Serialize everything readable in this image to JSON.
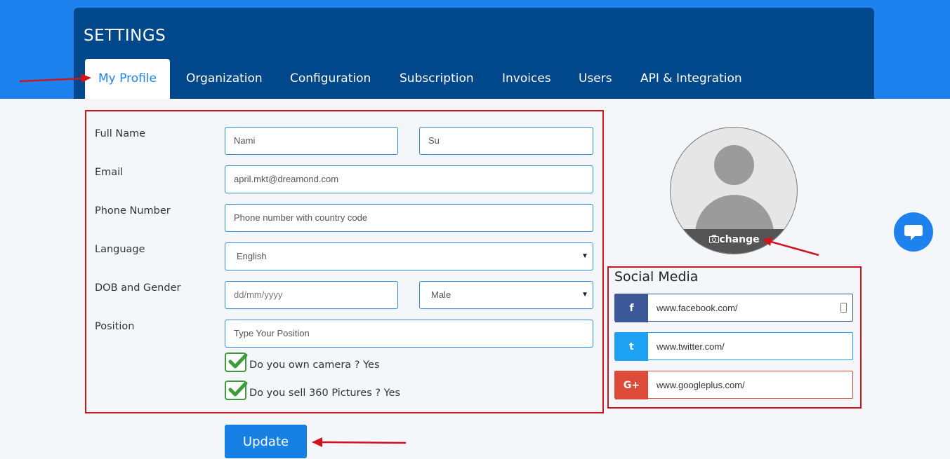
{
  "page": {
    "title": "SETTINGS"
  },
  "tabs": [
    {
      "label": "My Profile",
      "active": true
    },
    {
      "label": "Organization"
    },
    {
      "label": "Configuration"
    },
    {
      "label": "Subscription"
    },
    {
      "label": "Invoices"
    },
    {
      "label": "Users"
    },
    {
      "label": "API & Integration"
    }
  ],
  "form": {
    "full_name": {
      "label": "Full Name",
      "first": "Nami",
      "last": "Su"
    },
    "email": {
      "label": "Email",
      "value": "april.mkt@dreamond.com"
    },
    "phone": {
      "label": "Phone Number",
      "placeholder": "Phone number with country code"
    },
    "language": {
      "label": "Language",
      "selected": "English"
    },
    "dob_gender": {
      "label": "DOB and Gender",
      "dob_placeholder": "dd/mm/yyyy",
      "gender_selected": "Male"
    },
    "position": {
      "label": "Position",
      "placeholder": "Type Your Position"
    },
    "checkboxes": [
      {
        "label": "Do you own camera ? Yes",
        "checked": true
      },
      {
        "label": "Do you sell 360 Pictures ? Yes",
        "checked": true
      }
    ],
    "update_label": "Update"
  },
  "avatar": {
    "change_label": "change",
    "icon": "camera-icon"
  },
  "social": {
    "title": "Social Media",
    "items": [
      {
        "network": "facebook",
        "icon_text": "f",
        "value": "www.facebook.com/",
        "color": "#3b5998"
      },
      {
        "network": "twitter",
        "icon_text": "t",
        "value": "www.twitter.com/",
        "color": "#1da1f2"
      },
      {
        "network": "googleplus",
        "icon_text": "G+",
        "value": "www.googleplus.com/",
        "color": "#dd4b39"
      }
    ]
  },
  "colors": {
    "header": "#00478c",
    "accent": "#1e82ee",
    "highlight": "#d0141e",
    "check": "#3a9c3a"
  }
}
